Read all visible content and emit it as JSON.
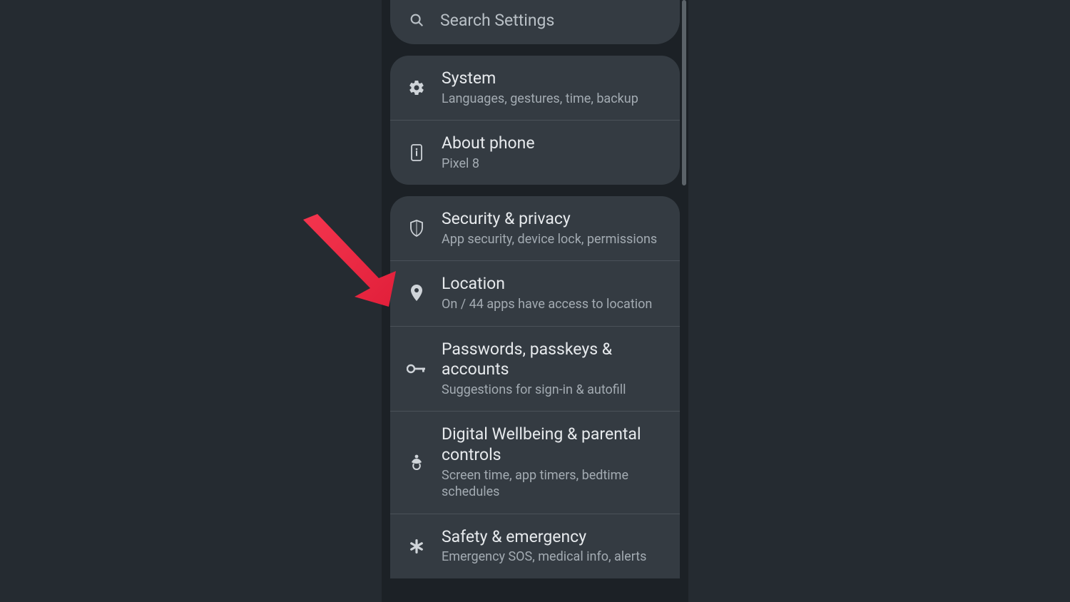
{
  "search": {
    "placeholder": "Search Settings"
  },
  "group1": {
    "system": {
      "title": "System",
      "subtitle": "Languages, gestures, time, backup"
    },
    "about": {
      "title": "About phone",
      "subtitle": "Pixel 8"
    }
  },
  "group2": {
    "security": {
      "title": "Security & privacy",
      "subtitle": "App security, device lock, permissions"
    },
    "location": {
      "title": "Location",
      "subtitle": "On / 44 apps have access to location"
    },
    "passwords": {
      "title": "Passwords, passkeys & accounts",
      "subtitle": "Suggestions for sign-in & autofill"
    },
    "wellbeing": {
      "title": "Digital Wellbeing & parental controls",
      "subtitle": "Screen time, app timers, bedtime schedules"
    },
    "safety": {
      "title": "Safety & emergency",
      "subtitle": "Emergency SOS, medical info, alerts"
    }
  },
  "annotation": {
    "target": "location",
    "color": "#f4354e"
  }
}
